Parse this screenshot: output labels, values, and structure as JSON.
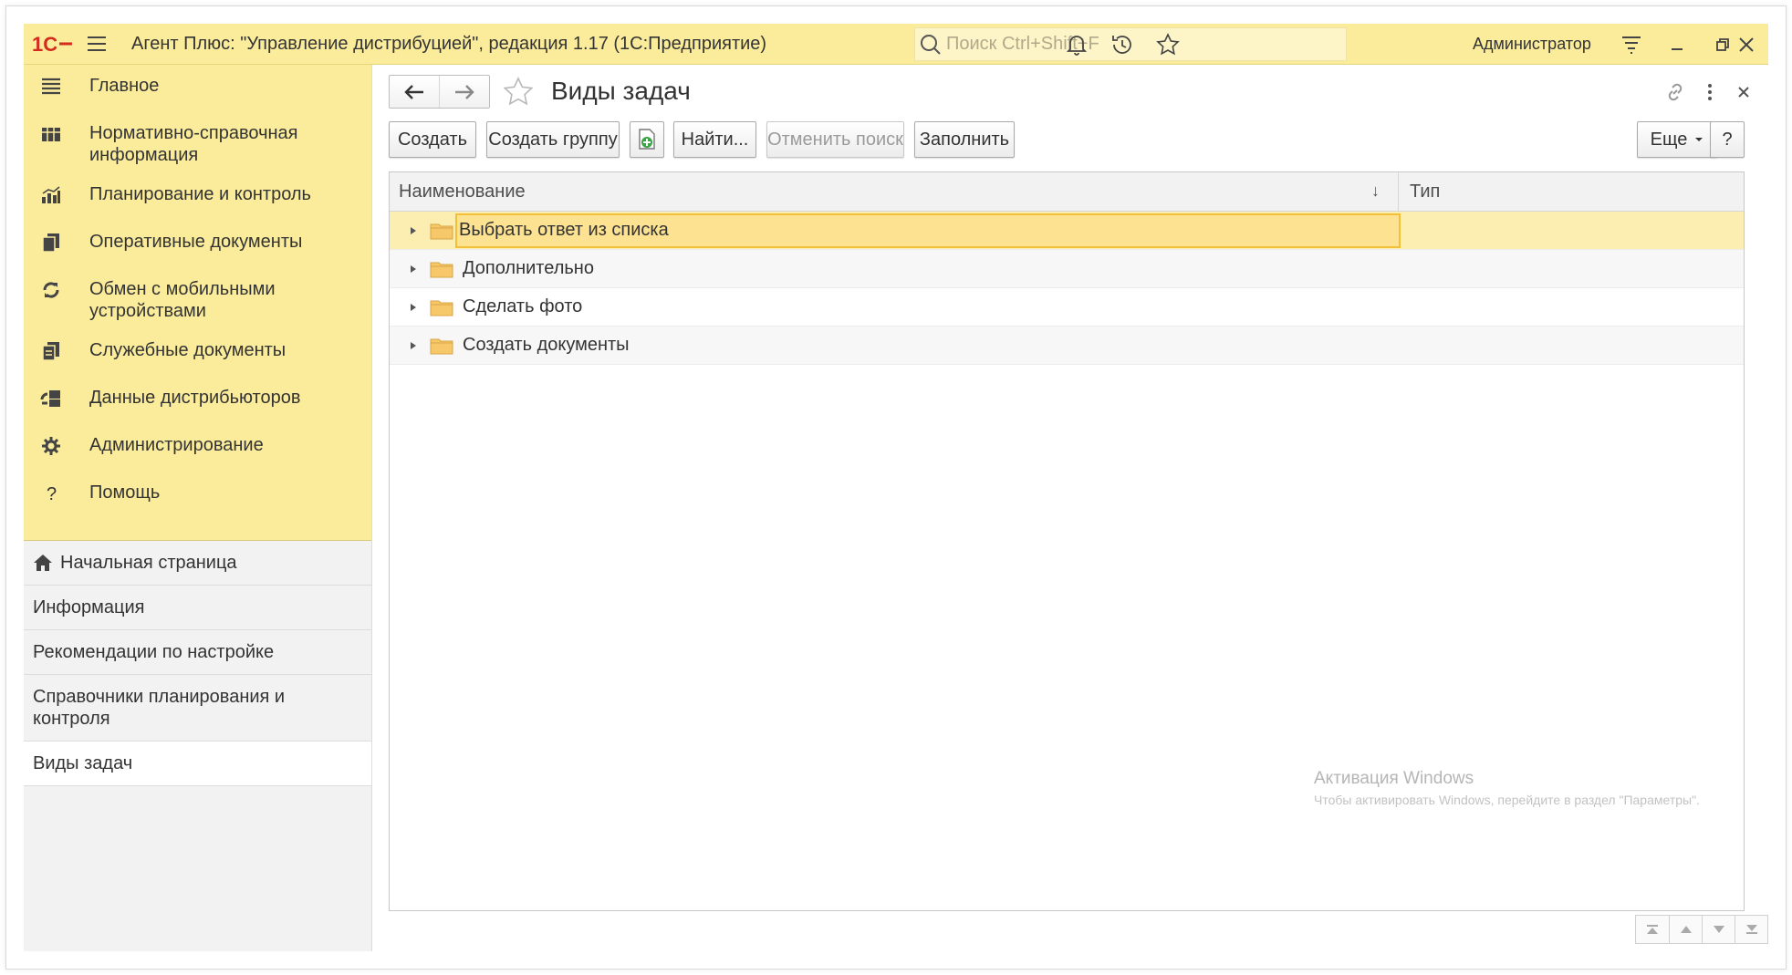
{
  "window": {
    "title": "Агент Плюс: \"Управление дистрибуцией\", редакция 1.17  (1С:Предприятие)",
    "search_placeholder": "Поиск Ctrl+Shift+F",
    "user": "Администратор",
    "accent_color": "#fbec9c"
  },
  "sidebar": {
    "sections": [
      {
        "label": "Главное",
        "icon": "hamburger-icon"
      },
      {
        "label": "Нормативно-справочная информация",
        "icon": "grid-icon"
      },
      {
        "label": "Планирование и контроль",
        "icon": "bar-chart-icon"
      },
      {
        "label": "Оперативные документы",
        "icon": "documents-icon"
      },
      {
        "label": "Обмен с мобильными устройствами",
        "icon": "sync-icon"
      },
      {
        "label": "Служебные документы",
        "icon": "service-docs-icon"
      },
      {
        "label": "Данные дистрибьюторов",
        "icon": "distributor-icon"
      },
      {
        "label": "Администрирование",
        "icon": "gear-icon"
      },
      {
        "label": "Помощь",
        "icon": "question-icon"
      }
    ],
    "open_windows": [
      {
        "label": "Начальная страница"
      },
      {
        "label": "Информация"
      },
      {
        "label": "Рекомендации по настройке"
      },
      {
        "label": "Справочники планирования и контроля"
      },
      {
        "label": "Виды задач"
      }
    ]
  },
  "form": {
    "title": "Виды задач",
    "buttons": {
      "create": "Создать",
      "create_group": "Создать группу",
      "find": "Найти...",
      "cancel_search": "Отменить поиск",
      "fill": "Заполнить",
      "more": "Еще",
      "help": "?"
    },
    "table": {
      "columns": [
        "Наименование",
        "Тип"
      ],
      "rows": [
        {
          "name": "Выбрать ответ из списка",
          "type": ""
        },
        {
          "name": "Дополнительно",
          "type": ""
        },
        {
          "name": "Сделать фото",
          "type": ""
        },
        {
          "name": "Создать документы",
          "type": ""
        }
      ]
    }
  },
  "watermark": {
    "title": "Активация Windows",
    "subtitle": "Чтобы активировать Windows, перейдите в раздел \"Параметры\"."
  }
}
